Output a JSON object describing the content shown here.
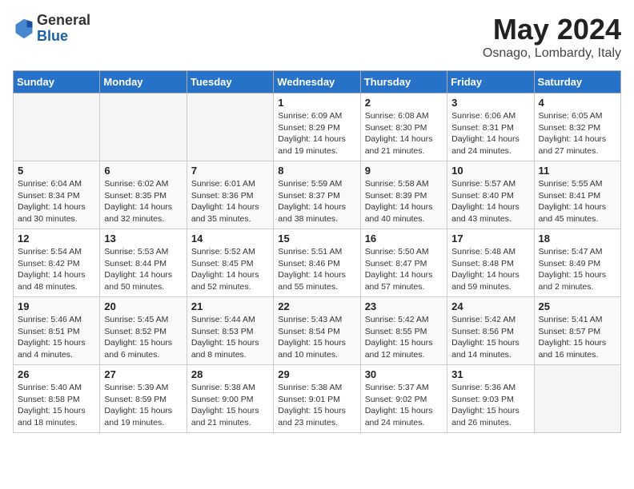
{
  "logo": {
    "general": "General",
    "blue": "Blue"
  },
  "title": "May 2024",
  "location": "Osnago, Lombardy, Italy",
  "days_header": [
    "Sunday",
    "Monday",
    "Tuesday",
    "Wednesday",
    "Thursday",
    "Friday",
    "Saturday"
  ],
  "weeks": [
    [
      {
        "num": "",
        "info": ""
      },
      {
        "num": "",
        "info": ""
      },
      {
        "num": "",
        "info": ""
      },
      {
        "num": "1",
        "info": "Sunrise: 6:09 AM\nSunset: 8:29 PM\nDaylight: 14 hours\nand 19 minutes."
      },
      {
        "num": "2",
        "info": "Sunrise: 6:08 AM\nSunset: 8:30 PM\nDaylight: 14 hours\nand 21 minutes."
      },
      {
        "num": "3",
        "info": "Sunrise: 6:06 AM\nSunset: 8:31 PM\nDaylight: 14 hours\nand 24 minutes."
      },
      {
        "num": "4",
        "info": "Sunrise: 6:05 AM\nSunset: 8:32 PM\nDaylight: 14 hours\nand 27 minutes."
      }
    ],
    [
      {
        "num": "5",
        "info": "Sunrise: 6:04 AM\nSunset: 8:34 PM\nDaylight: 14 hours\nand 30 minutes."
      },
      {
        "num": "6",
        "info": "Sunrise: 6:02 AM\nSunset: 8:35 PM\nDaylight: 14 hours\nand 32 minutes."
      },
      {
        "num": "7",
        "info": "Sunrise: 6:01 AM\nSunset: 8:36 PM\nDaylight: 14 hours\nand 35 minutes."
      },
      {
        "num": "8",
        "info": "Sunrise: 5:59 AM\nSunset: 8:37 PM\nDaylight: 14 hours\nand 38 minutes."
      },
      {
        "num": "9",
        "info": "Sunrise: 5:58 AM\nSunset: 8:39 PM\nDaylight: 14 hours\nand 40 minutes."
      },
      {
        "num": "10",
        "info": "Sunrise: 5:57 AM\nSunset: 8:40 PM\nDaylight: 14 hours\nand 43 minutes."
      },
      {
        "num": "11",
        "info": "Sunrise: 5:55 AM\nSunset: 8:41 PM\nDaylight: 14 hours\nand 45 minutes."
      }
    ],
    [
      {
        "num": "12",
        "info": "Sunrise: 5:54 AM\nSunset: 8:42 PM\nDaylight: 14 hours\nand 48 minutes."
      },
      {
        "num": "13",
        "info": "Sunrise: 5:53 AM\nSunset: 8:44 PM\nDaylight: 14 hours\nand 50 minutes."
      },
      {
        "num": "14",
        "info": "Sunrise: 5:52 AM\nSunset: 8:45 PM\nDaylight: 14 hours\nand 52 minutes."
      },
      {
        "num": "15",
        "info": "Sunrise: 5:51 AM\nSunset: 8:46 PM\nDaylight: 14 hours\nand 55 minutes."
      },
      {
        "num": "16",
        "info": "Sunrise: 5:50 AM\nSunset: 8:47 PM\nDaylight: 14 hours\nand 57 minutes."
      },
      {
        "num": "17",
        "info": "Sunrise: 5:48 AM\nSunset: 8:48 PM\nDaylight: 14 hours\nand 59 minutes."
      },
      {
        "num": "18",
        "info": "Sunrise: 5:47 AM\nSunset: 8:49 PM\nDaylight: 15 hours\nand 2 minutes."
      }
    ],
    [
      {
        "num": "19",
        "info": "Sunrise: 5:46 AM\nSunset: 8:51 PM\nDaylight: 15 hours\nand 4 minutes."
      },
      {
        "num": "20",
        "info": "Sunrise: 5:45 AM\nSunset: 8:52 PM\nDaylight: 15 hours\nand 6 minutes."
      },
      {
        "num": "21",
        "info": "Sunrise: 5:44 AM\nSunset: 8:53 PM\nDaylight: 15 hours\nand 8 minutes."
      },
      {
        "num": "22",
        "info": "Sunrise: 5:43 AM\nSunset: 8:54 PM\nDaylight: 15 hours\nand 10 minutes."
      },
      {
        "num": "23",
        "info": "Sunrise: 5:42 AM\nSunset: 8:55 PM\nDaylight: 15 hours\nand 12 minutes."
      },
      {
        "num": "24",
        "info": "Sunrise: 5:42 AM\nSunset: 8:56 PM\nDaylight: 15 hours\nand 14 minutes."
      },
      {
        "num": "25",
        "info": "Sunrise: 5:41 AM\nSunset: 8:57 PM\nDaylight: 15 hours\nand 16 minutes."
      }
    ],
    [
      {
        "num": "26",
        "info": "Sunrise: 5:40 AM\nSunset: 8:58 PM\nDaylight: 15 hours\nand 18 minutes."
      },
      {
        "num": "27",
        "info": "Sunrise: 5:39 AM\nSunset: 8:59 PM\nDaylight: 15 hours\nand 19 minutes."
      },
      {
        "num": "28",
        "info": "Sunrise: 5:38 AM\nSunset: 9:00 PM\nDaylight: 15 hours\nand 21 minutes."
      },
      {
        "num": "29",
        "info": "Sunrise: 5:38 AM\nSunset: 9:01 PM\nDaylight: 15 hours\nand 23 minutes."
      },
      {
        "num": "30",
        "info": "Sunrise: 5:37 AM\nSunset: 9:02 PM\nDaylight: 15 hours\nand 24 minutes."
      },
      {
        "num": "31",
        "info": "Sunrise: 5:36 AM\nSunset: 9:03 PM\nDaylight: 15 hours\nand 26 minutes."
      },
      {
        "num": "",
        "info": ""
      }
    ]
  ]
}
